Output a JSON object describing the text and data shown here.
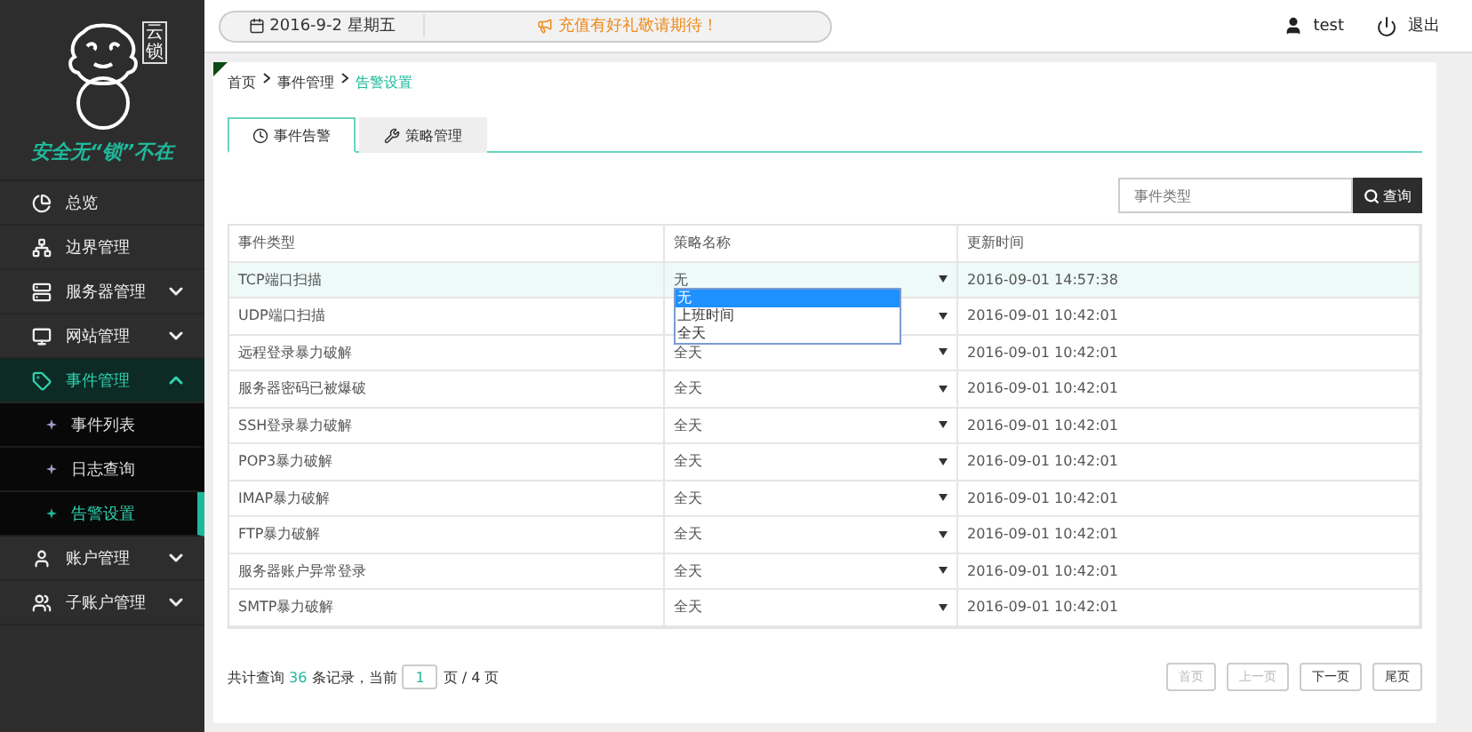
{
  "logo": {
    "seal": "云锁",
    "slogan": "安全无“锁”不在"
  },
  "sidebar": {
    "items": [
      {
        "label": "总览",
        "kind": "link",
        "expanded": false
      },
      {
        "label": "边界管理",
        "kind": "link",
        "expanded": false
      },
      {
        "label": "服务器管理",
        "kind": "group",
        "expanded": false
      },
      {
        "label": "网站管理",
        "kind": "group",
        "expanded": false
      },
      {
        "label": "事件管理",
        "kind": "group",
        "expanded": true,
        "children": [
          {
            "label": "事件列表",
            "selected": false
          },
          {
            "label": "日志查询",
            "selected": false
          },
          {
            "label": "告警设置",
            "selected": true
          }
        ]
      },
      {
        "label": "账户管理",
        "kind": "group",
        "expanded": false
      },
      {
        "label": "子账户管理",
        "kind": "group",
        "expanded": false
      }
    ]
  },
  "topbar": {
    "date": "2016-9-2 星期五",
    "notice": "充值有好礼敬请期待！",
    "user": "test",
    "logout": "退出"
  },
  "breadcrumb": [
    "首页",
    "事件管理",
    "告警设置"
  ],
  "tabs": [
    {
      "label": "事件告警",
      "selected": true
    },
    {
      "label": "策略管理",
      "selected": false
    }
  ],
  "search": {
    "placeholder": "事件类型",
    "button": "查询"
  },
  "table": {
    "columns": [
      "事件类型",
      "策略名称",
      "更新时间"
    ],
    "rows": [
      {
        "event": "TCP端口扫描",
        "policy": "无",
        "time": "2016-09-01 14:57:38",
        "selected": true,
        "open": true,
        "options": [
          {
            "label": "无",
            "selected": true
          },
          {
            "label": "上班时间",
            "selected": false
          },
          {
            "label": "全天",
            "selected": false
          }
        ]
      },
      {
        "event": "UDP端口扫描",
        "time": "2016-09-01 10:42:01",
        "selected": false,
        "open": false
      },
      {
        "event": "远程登录暴力破解",
        "policy": "全天",
        "time": "2016-09-01 10:42:01",
        "selected": false,
        "open": false
      },
      {
        "event": "服务器密码已被爆破",
        "policy": "全天",
        "time": "2016-09-01 10:42:01",
        "selected": false,
        "open": false
      },
      {
        "event": "SSH登录暴力破解",
        "policy": "全天",
        "time": "2016-09-01 10:42:01",
        "selected": false,
        "open": false
      },
      {
        "event": "POP3暴力破解",
        "policy": "全天",
        "time": "2016-09-01 10:42:01",
        "selected": false,
        "open": false
      },
      {
        "event": "IMAP暴力破解",
        "policy": "全天",
        "time": "2016-09-01 10:42:01",
        "selected": false,
        "open": false
      },
      {
        "event": "FTP暴力破解",
        "policy": "全天",
        "time": "2016-09-01 10:42:01",
        "selected": false,
        "open": false
      },
      {
        "event": "服务器账户异常登录",
        "policy": "全天",
        "time": "2016-09-01 10:42:01",
        "selected": false,
        "open": false
      },
      {
        "event": "SMTP暴力破解",
        "policy": "全天",
        "time": "2016-09-01 10:42:01",
        "selected": false,
        "open": false
      }
    ]
  },
  "pagination": {
    "prefix": "共计查询",
    "total": "36",
    "middle": "条记录，当前",
    "page": "1",
    "suffix": "页 / 4 页",
    "buttons": [
      {
        "label": "首页",
        "disabled": true
      },
      {
        "label": "上一页",
        "disabled": true
      },
      {
        "label": "下一页",
        "disabled": false
      },
      {
        "label": "尾页",
        "disabled": false
      }
    ]
  }
}
